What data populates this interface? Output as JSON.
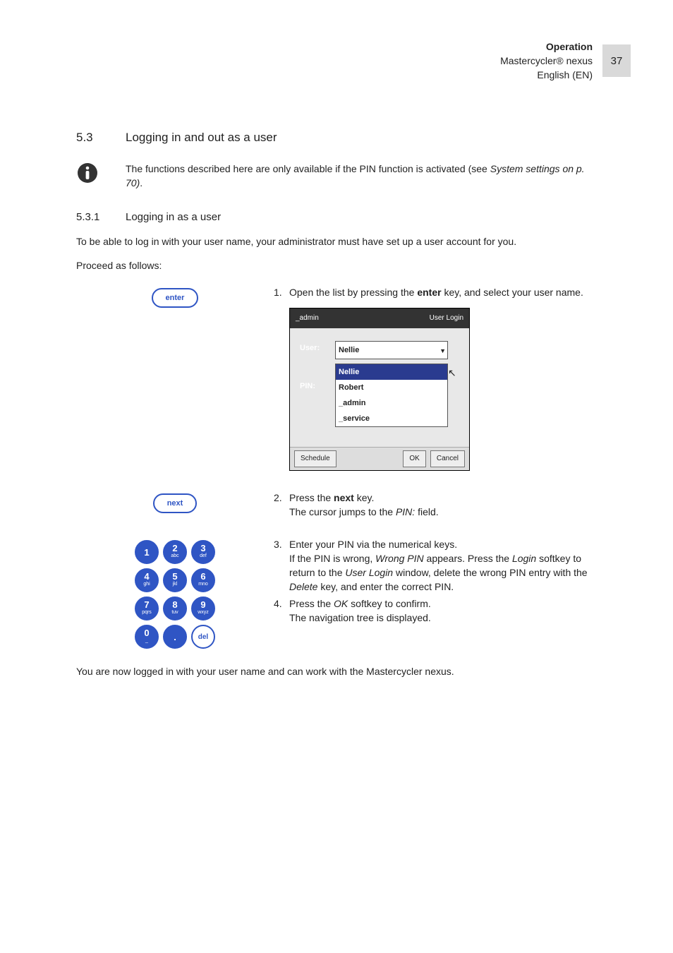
{
  "header": {
    "chapter": "Operation",
    "product": "Mastercycler® nexus",
    "lang": "English (EN)",
    "page": "37"
  },
  "h1": {
    "num": "5.3",
    "title": "Logging in and out as a user"
  },
  "info": {
    "text_a": "The functions described here are only available if the PIN function is activated (see ",
    "text_i": "System settings on p. 70)",
    "text_b": "."
  },
  "h2": {
    "num": "5.3.1",
    "title": "Logging in as a user"
  },
  "intro1": "To be able to log in with your user name, your administrator must have set up a user account for you.",
  "intro2": "Proceed as follows:",
  "keys": {
    "enter": "enter",
    "next": "next",
    "del": "del"
  },
  "step1": {
    "n": "1.",
    "a": "Open the list by pressing the ",
    "b": "enter",
    "c": " key, and select your user name."
  },
  "ss": {
    "top_left": "_admin",
    "top_right": "User Login",
    "label_user": "User:",
    "label_pin": "PIN:",
    "selected": "Nellie",
    "options": [
      "Nellie",
      "Robert",
      "_admin",
      "_service"
    ],
    "btn_schedule": "Schedule",
    "btn_ok": "OK",
    "btn_cancel": "Cancel"
  },
  "step2": {
    "n": "2.",
    "a": "Press the ",
    "b": "next",
    "c": " key.",
    "d": "The cursor jumps to the ",
    "e": "PIN:",
    "f": " field."
  },
  "step3": {
    "n": "3.",
    "a": "Enter your PIN via the numerical keys.",
    "b": "If the PIN is wrong, ",
    "c": "Wrong PIN",
    "d": " appears. Press the ",
    "e": "Login",
    "f": " softkey to return to the ",
    "g": "User Login",
    "h": " window, delete the wrong PIN entry with the ",
    "i": "Delete",
    "j": " key, and enter the correct PIN."
  },
  "step4": {
    "n": "4.",
    "a": "Press the ",
    "b": "OK",
    "c": " softkey to confirm.",
    "d": "The navigation tree is displayed."
  },
  "outro": "You are now logged in with your user name and can work with the Mastercycler nexus.",
  "keypad": [
    {
      "big": "1",
      "sm": ""
    },
    {
      "big": "2",
      "sm": "abc"
    },
    {
      "big": "3",
      "sm": "def"
    },
    {
      "big": "4",
      "sm": "ghi"
    },
    {
      "big": "5",
      "sm": "jkl"
    },
    {
      "big": "6",
      "sm": "mno"
    },
    {
      "big": "7",
      "sm": "pqrs"
    },
    {
      "big": "8",
      "sm": "tuv"
    },
    {
      "big": "9",
      "sm": "wxyz"
    },
    {
      "big": "0",
      "sm": "_"
    },
    {
      "big": ".",
      "sm": ""
    }
  ]
}
